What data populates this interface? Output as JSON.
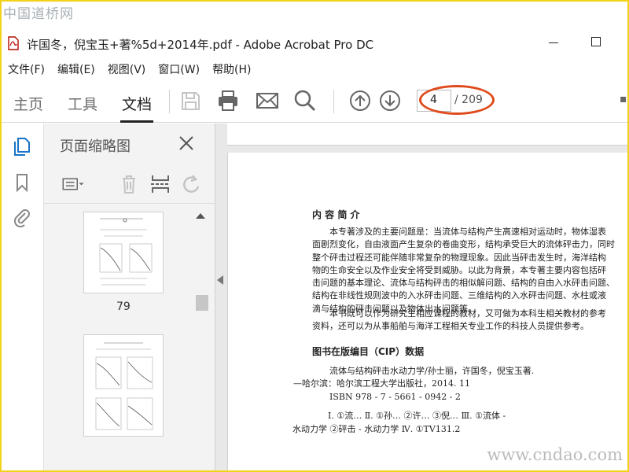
{
  "watermark": {
    "top": "中国道桥网",
    "bottom": "www.cndao.com"
  },
  "window": {
    "title": "许国冬，倪宝玉+著%5d+2014年.pdf - Adobe Acrobat Pro DC"
  },
  "menu": [
    "文件(F)",
    "编辑(E)",
    "视图(V)",
    "窗口(W)",
    "帮助(H)"
  ],
  "tabs": [
    {
      "label": "主页",
      "active": false
    },
    {
      "label": "工具",
      "active": false
    },
    {
      "label": "文档",
      "active": true
    }
  ],
  "toolbar": {
    "icons": [
      "save-icon",
      "print-icon",
      "email-icon",
      "search-icon",
      "page-up-icon",
      "page-down-icon"
    ],
    "page_current": "4",
    "page_total": "/ 209",
    "highlight_color": "#e04b1d"
  },
  "sidebar": {
    "panel_title": "页面缩略图",
    "thumbnails": [
      {
        "label": "79"
      },
      {
        "label": ""
      }
    ]
  },
  "document": {
    "heading": "内 容 简 介",
    "paragraph1": [
      "本专著涉及的主要问题是：当流体与结构产生高速相对运动时，物体湿表",
      "面剧烈变化，自由液面产生复杂的卷曲变形，结构承受巨大的流体砰击力，同时",
      "整个砰击过程还可能伴随非常复杂的物理现象。因此当砰击发生时，海洋结构",
      "物的生命安全以及作业安全将受到威胁。以此为背景，本专著主要内容包括砰",
      "击问题的基本理论、流体与结构砰击的相似解问题、结构的自由入水砰击问题、",
      "结构在非线性规则波中的入水砰击问题、三维结构的入水砰击问题、水柱或液",
      "滴与结构的砰击问题以及物体出水问题等。"
    ],
    "paragraph2": [
      "本书既可以作为研究生相应课程的教材，又可做为本科生相关教材的参考",
      "资料，还可以为从事船舶与海洋工程相关专业工作的科技人员提供参考。"
    ],
    "cip_heading": "图书在版编目（CIP）数据",
    "cip_lines": [
      "流体与结构砰击水动力学/孙士丽，许国冬，倪宝玉著.",
      "—哈尔滨：哈尔滨工程大学出版社，2014. 11",
      "ISBN 978 - 7 - 5661 - 0942 - 2"
    ],
    "cip_class_line": "Ⅰ. ①流…  Ⅱ. ①孙… ②许… ③倪…  Ⅲ. ①流体 -",
    "cip_partial_line": "水动力学 ②砰击 - 水动力学  Ⅳ. ①TV131.2"
  }
}
